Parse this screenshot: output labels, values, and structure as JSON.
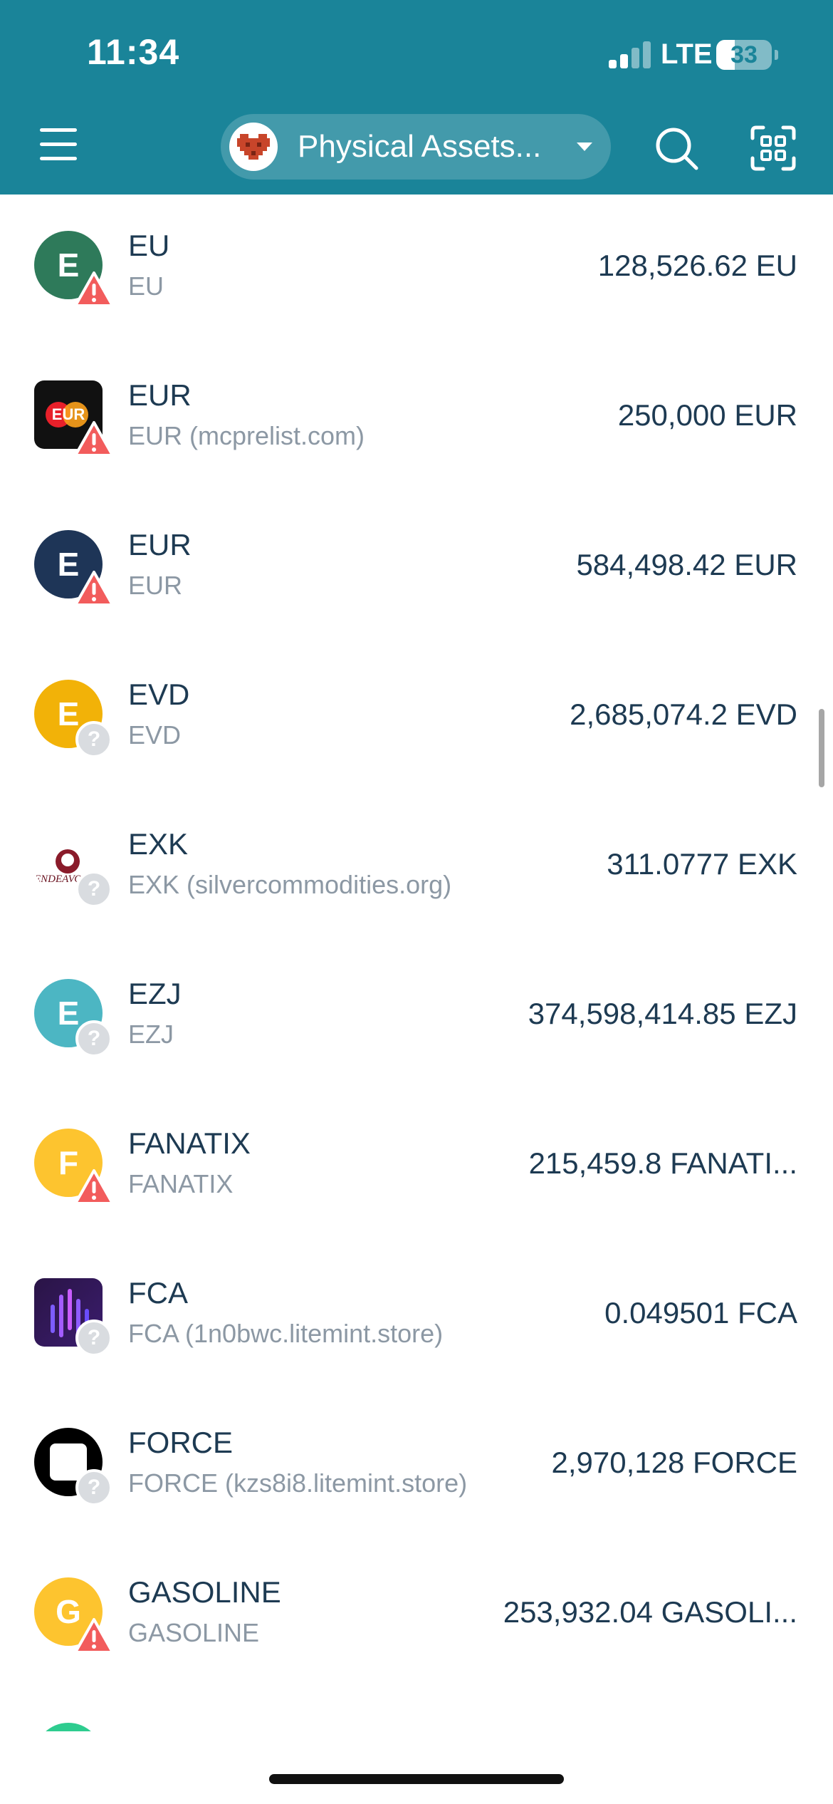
{
  "status_bar": {
    "time": "11:34",
    "network": "LTE",
    "battery": "33"
  },
  "header": {
    "account_name": "Physical Assets..."
  },
  "assets": [
    {
      "code": "EU",
      "subtitle": "EU",
      "balance": "128,526.62 EU",
      "icon_letter": "E",
      "icon_color": "#2e7a5a",
      "badge": "warning"
    },
    {
      "code": "EUR",
      "subtitle": "EUR (mcprelist.com)",
      "balance": "250,000 EUR",
      "icon_type": "eur-logo",
      "badge": "warning"
    },
    {
      "code": "EUR",
      "subtitle": "EUR",
      "balance": "584,498.42 EUR",
      "icon_letter": "E",
      "icon_color": "#1e3557",
      "badge": "warning"
    },
    {
      "code": "EVD",
      "subtitle": "EVD",
      "balance": "2,685,074.2 EVD",
      "icon_letter": "E",
      "icon_color": "#f2b208",
      "badge": "unknown"
    },
    {
      "code": "EXK",
      "subtitle": "EXK (silvercommodities.org)",
      "balance": "311.0777 EXK",
      "icon_type": "endeavour-logo",
      "icon_text": "ENDEAVO",
      "badge": "unknown"
    },
    {
      "code": "EZJ",
      "subtitle": "EZJ",
      "balance": "374,598,414.85 EZJ",
      "icon_letter": "E",
      "icon_color": "#4cb6c3",
      "badge": "unknown"
    },
    {
      "code": "FANATIX",
      "subtitle": "FANATIX",
      "balance": "215,459.8 FANATI...",
      "icon_letter": "F",
      "icon_color": "#fdc42f",
      "badge": "warning"
    },
    {
      "code": "FCA",
      "subtitle": "FCA (1n0bwc.litemint.store)",
      "balance": "0.049501 FCA",
      "icon_type": "fca-logo",
      "badge": "unknown"
    },
    {
      "code": "FORCE",
      "subtitle": "FORCE (kzs8i8.litemint.store)",
      "balance": "2,970,128 FORCE",
      "icon_type": "force-logo",
      "badge": "unknown"
    },
    {
      "code": "GASOLINE",
      "subtitle": "GASOLINE",
      "balance": "253,932.04 GASOLI...",
      "icon_letter": "G",
      "icon_color": "#fdc42f",
      "badge": "warning"
    }
  ],
  "eur_logo_text": "EUR",
  "badges": {
    "unknown_glyph": "?"
  },
  "colors": {
    "header": "#1a8499",
    "text": "#1d3a52",
    "subtext": "#8c98a4",
    "warning": "#f25c5c"
  }
}
